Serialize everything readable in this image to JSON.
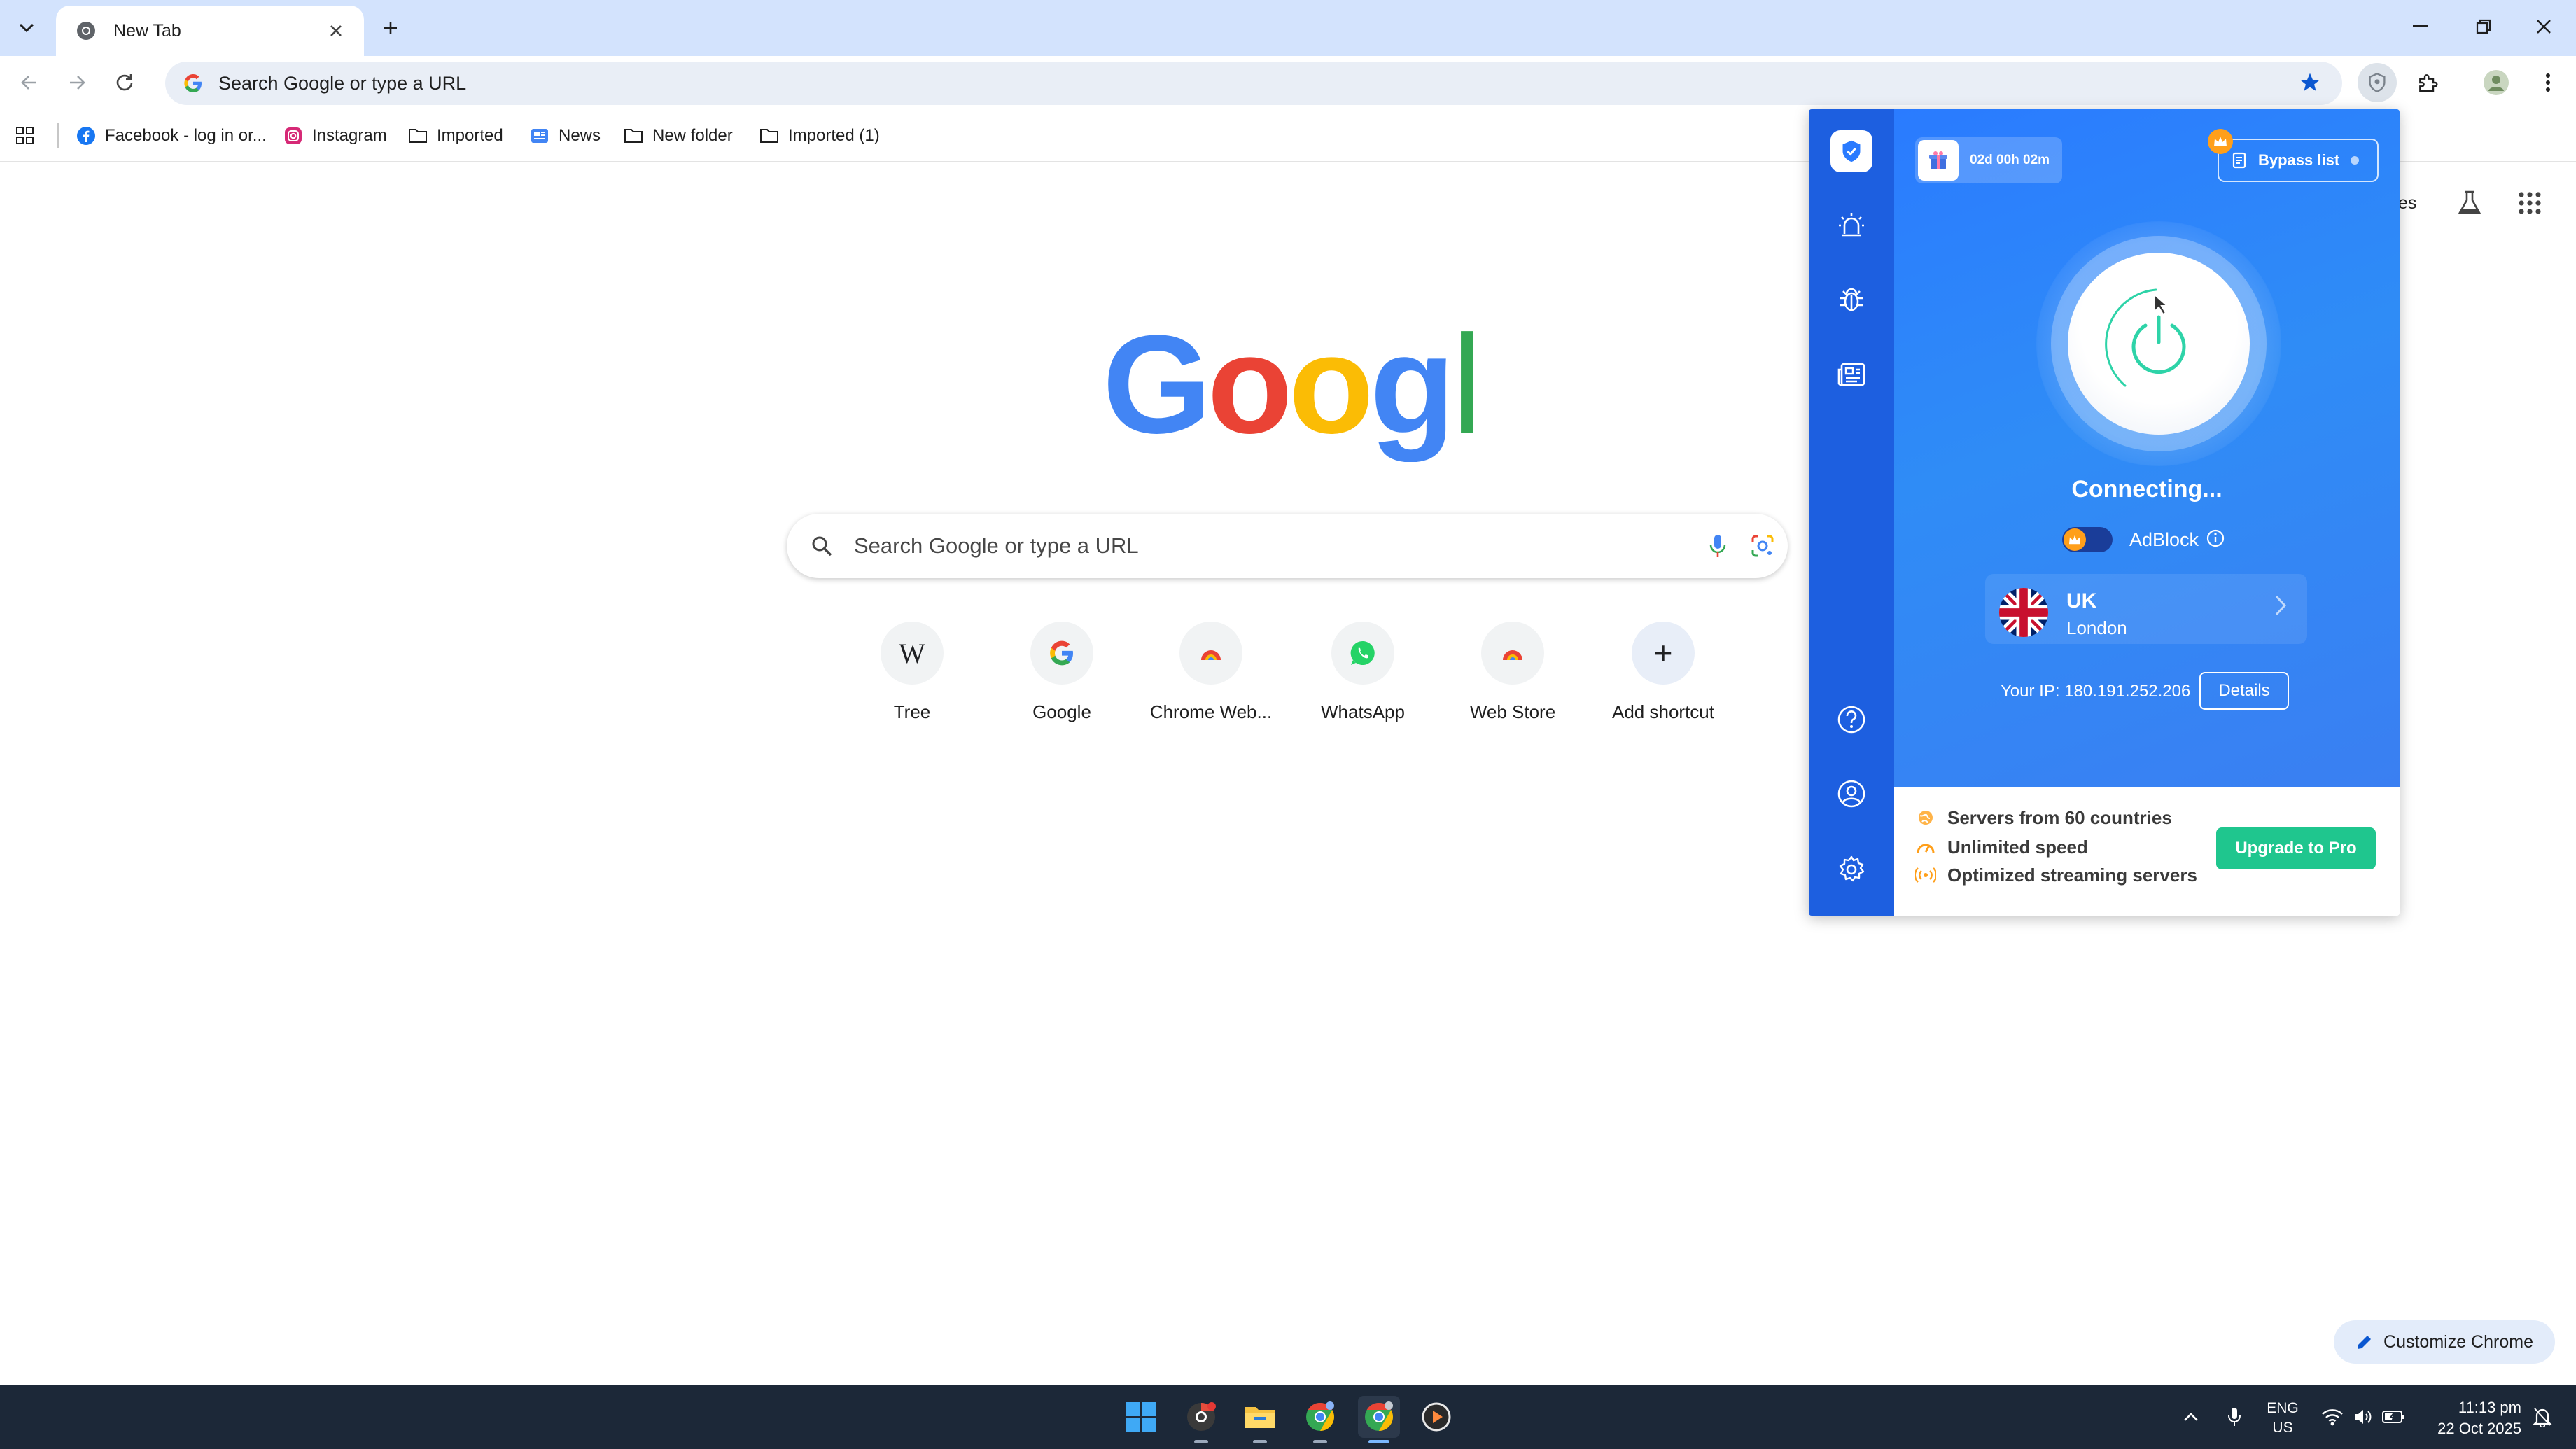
{
  "browser": {
    "tab_title": "New Tab",
    "omnibox_placeholder": "Search Google or type a URL",
    "bookmarks": [
      {
        "label": "Facebook - log in or..."
      },
      {
        "label": "Instagram"
      },
      {
        "label": "Imported"
      },
      {
        "label": "News"
      },
      {
        "label": "New folder"
      },
      {
        "label": "Imported (1)"
      }
    ]
  },
  "ntp": {
    "search_placeholder": "Search Google or type a URL",
    "shortcuts": [
      {
        "label": "Tree",
        "glyph": "W"
      },
      {
        "label": "Google"
      },
      {
        "label": "Chrome Web..."
      },
      {
        "label": "WhatsApp"
      },
      {
        "label": "Web Store"
      },
      {
        "label": "Add shortcut",
        "glyph": "+"
      }
    ],
    "partial_text": "es",
    "customize_label": "Customize Chrome"
  },
  "vpn": {
    "timer": "02d 00h 02m",
    "bypass_label": "Bypass list",
    "status": "Connecting...",
    "adblock_label": "AdBlock",
    "location": {
      "country": "UK",
      "city": "London"
    },
    "ip_text": "Your IP: 180.191.252.206",
    "details_label": "Details",
    "features": [
      "Servers from 60 countries",
      "Unlimited speed",
      "Optimized streaming servers"
    ],
    "upgrade_label": "Upgrade to Pro",
    "colors": {
      "primary": "#2a7bff",
      "sidebar": "#1d5fe0",
      "upgrade": "#1fc68e",
      "accent": "#ff9f1a"
    }
  },
  "taskbar": {
    "lang_line1": "ENG",
    "lang_line2": "US",
    "time": "11:13 pm",
    "date": "22 Oct 2025"
  }
}
